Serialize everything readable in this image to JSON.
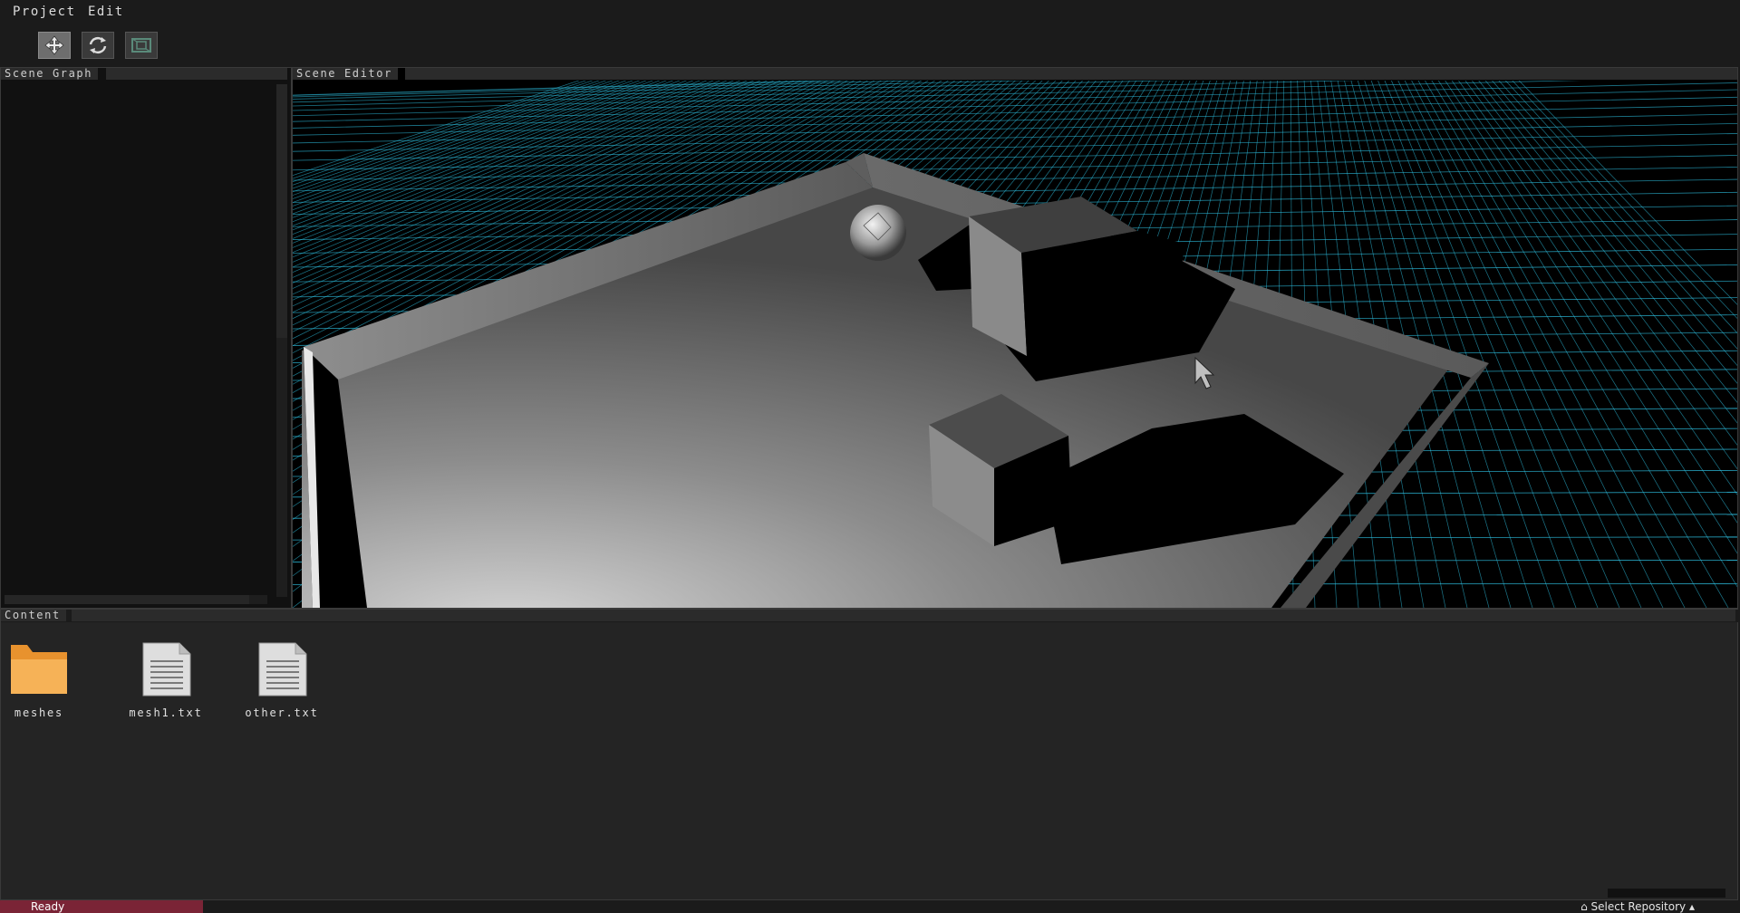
{
  "menu": {
    "project": "Project",
    "edit": "Edit"
  },
  "toolbar": {
    "buttons": [
      {
        "icon": "move-icon",
        "active": true
      },
      {
        "icon": "rotate-icon",
        "active": false
      },
      {
        "icon": "scale-icon",
        "active": false
      }
    ]
  },
  "panels": {
    "scene_graph_title": "Scene Graph",
    "scene_editor_title": "Scene Editor",
    "content_title": "Content"
  },
  "content": {
    "items": [
      {
        "name": "meshes",
        "icon": "folder-icon"
      },
      {
        "name": "mesh1.txt",
        "icon": "text-file-icon"
      },
      {
        "name": "other.txt",
        "icon": "text-file-icon"
      }
    ]
  },
  "status": {
    "ready": "Ready",
    "repository": "Select Repository"
  },
  "colors": {
    "grid": "#2ec4e6",
    "status_accent": "#7a2436",
    "folder": "#f3a03c"
  }
}
